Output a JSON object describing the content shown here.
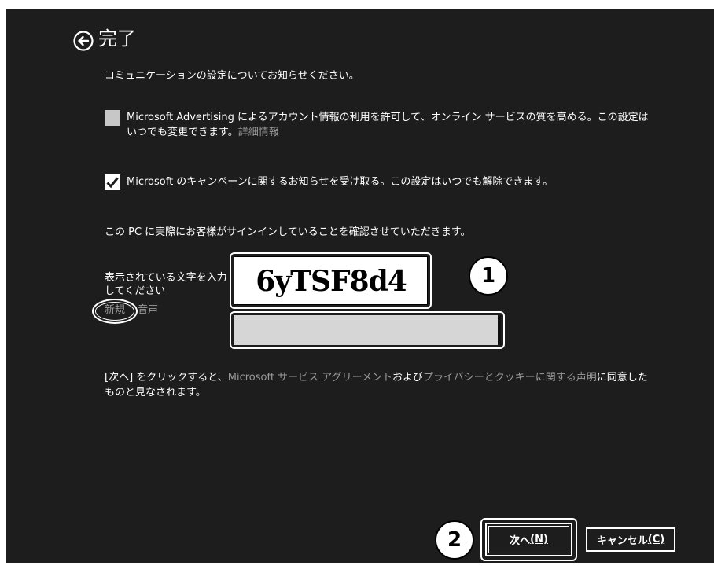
{
  "header": {
    "title": "完了"
  },
  "intro": "コミュニケーションの設定についてお知らせください。",
  "options": [
    {
      "checked": false,
      "text": "Microsoft Advertising によるアカウント情報の利用を許可して、オンライン サービスの質を高める。この設定はいつでも変更できます。",
      "link": "詳細情報"
    },
    {
      "checked": true,
      "text": "Microsoft のキャンペーンに関するお知らせを受け取る。この設定はいつでも解除できます。"
    }
  ],
  "pc_text": "この PC に実際にお客様がサインインしていることを確認させていただきます。",
  "captcha": {
    "label": "表示されている文字を入力してください",
    "new_link": "新規",
    "audio_link": "音声",
    "image_text": "6yTSF8d4",
    "input_value": ""
  },
  "agreement": {
    "prefix": "[次へ] をクリックすると、",
    "link1": "Microsoft サービス アグリーメント",
    "middle": "および",
    "link2": "プライバシーとクッキーに関する声明",
    "suffix": "に同意したものと見なされます。"
  },
  "buttons": {
    "next_label": "次へ",
    "next_key": "(N)",
    "cancel_label": "キャンセル",
    "cancel_key": "(C)"
  },
  "annotations": {
    "badge1": "1",
    "badge2": "2"
  },
  "colors": {
    "background": "#1d1d1d",
    "link": "#9a9a9a",
    "text": "#ffffff",
    "input_bg": "#d6d6d6"
  }
}
